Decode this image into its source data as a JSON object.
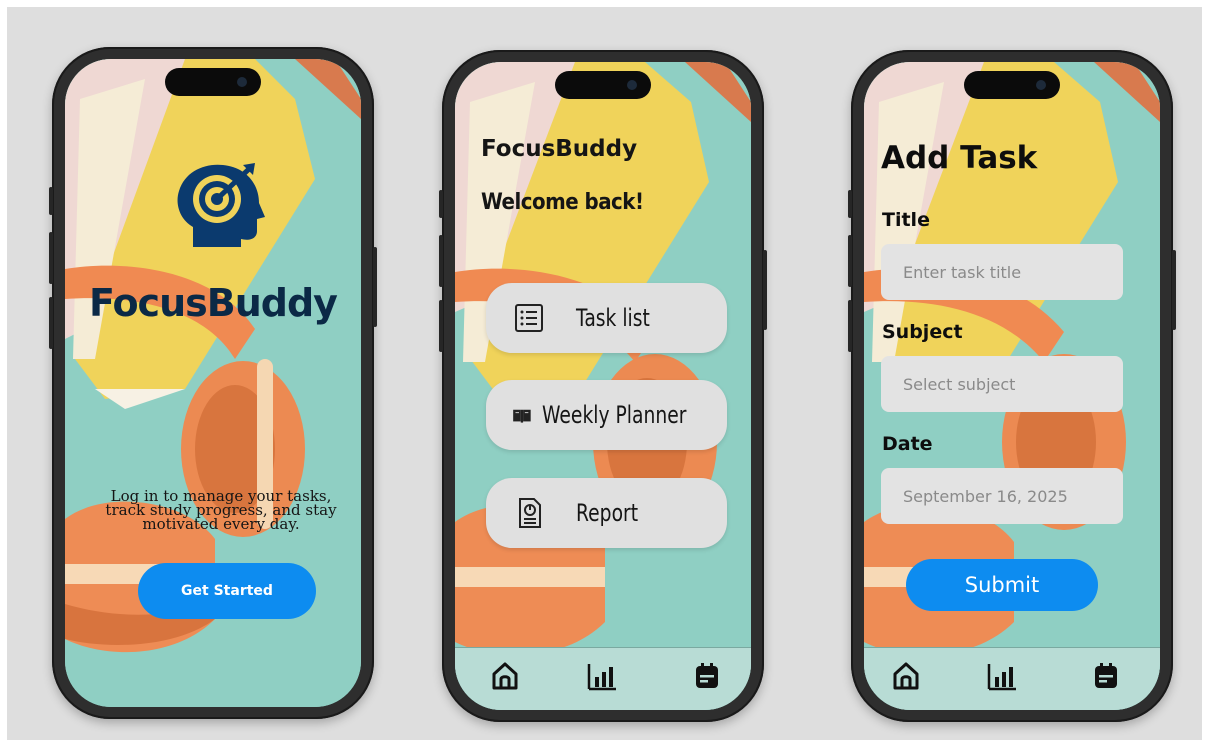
{
  "screens": {
    "welcome": {
      "app_name": "FocusBuddy",
      "tagline": "Log in to manage your tasks, track study progress, and stay motivated every day.",
      "cta_label": "Get Started",
      "logo_icon": "target-head-icon"
    },
    "home": {
      "app_name": "FocusBuddy",
      "greeting": "Welcome back!",
      "menu": [
        {
          "label": "Task list",
          "icon": "list-icon"
        },
        {
          "label": "Weekly Planner",
          "icon": "book-icon"
        },
        {
          "label": "Report",
          "icon": "report-icon"
        }
      ],
      "nav": [
        "home-icon",
        "chart-icon",
        "calendar-icon"
      ]
    },
    "add_task": {
      "title": "Add Task",
      "fields": [
        {
          "label": "Title",
          "placeholder": "Enter task title"
        },
        {
          "label": "Subject",
          "placeholder": "Select subject"
        },
        {
          "label": "Date",
          "value": "September 16, 2025"
        }
      ],
      "submit_label": "Submit",
      "nav": [
        "home-icon",
        "chart-icon",
        "calendar-icon"
      ]
    }
  },
  "colors": {
    "accent": "#0d8cf0",
    "background": "#8fcfc3",
    "logo_navy": "#0b2946",
    "button_grey": "#e0e0e0"
  }
}
